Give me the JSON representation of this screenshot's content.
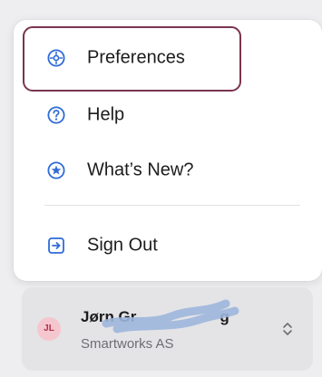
{
  "menu": {
    "items": [
      {
        "label": "Preferences",
        "icon": "gear-icon"
      },
      {
        "label": "Help",
        "icon": "help-circle-icon"
      },
      {
        "label": "What’s New?",
        "icon": "star-circle-icon"
      },
      {
        "label": "Sign Out",
        "icon": "sign-out-icon"
      }
    ],
    "focused_item": "Preferences"
  },
  "account": {
    "initials": "JL",
    "name": "Jørn Gr",
    "name_end": "g",
    "company": "Smartworks AS"
  },
  "colors": {
    "accent": "#2f6bd6",
    "focus_ring": "#7a3450",
    "avatar_bg": "#f6c6cf",
    "avatar_text": "#b0304b",
    "redaction": "#9db6dc"
  }
}
